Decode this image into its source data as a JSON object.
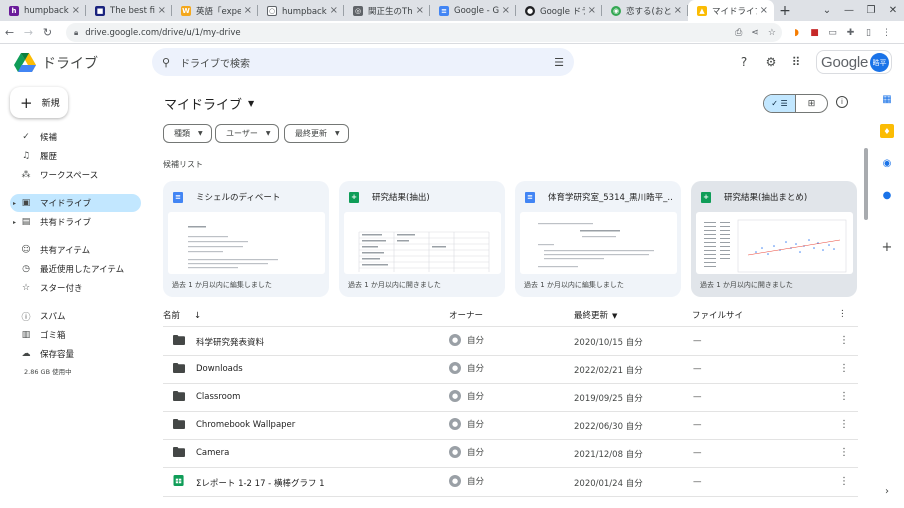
{
  "browser": {
    "tabs": [
      {
        "title": "humpback w",
        "fav_color": "#6a1b9a",
        "fav_glyph": "h"
      },
      {
        "title": "The best fits",
        "fav_color": "#1a237e",
        "fav_glyph": "■"
      },
      {
        "title": "英語「expen",
        "fav_color": "#f4a81d",
        "fav_glyph": "W"
      },
      {
        "title": "humpbackの",
        "fav_color": "#ffffff",
        "fav_glyph": "○"
      },
      {
        "title": "関正生のThe",
        "fav_color": "#5f6368",
        "fav_glyph": "◎"
      },
      {
        "title": "Google - Goo",
        "fav_color": "#4285f4",
        "fav_glyph": "≡"
      },
      {
        "title": "Google ドラ",
        "fav_color": "#202124",
        "fav_glyph": "●"
      },
      {
        "title": "恋する(おと",
        "fav_color": "#34a853",
        "fav_glyph": "◉"
      },
      {
        "title": "マイドライブ -",
        "fav_color": "#fbbc04",
        "fav_glyph": "▲"
      }
    ],
    "url": "drive.google.com/drive/u/1/my-drive"
  },
  "header": {
    "app_name": "ドライブ",
    "search_placeholder": "ドライブで検索",
    "google_word": "Google",
    "avatar_text": "晧平"
  },
  "sidebar": {
    "new_label": "新規",
    "items": [
      {
        "label": "候補",
        "icon": "check-circle-icon",
        "glyph": "✓"
      },
      {
        "label": "履歴",
        "icon": "bell-icon",
        "glyph": "♫"
      },
      {
        "label": "ワークスペース",
        "icon": "workspace-icon",
        "glyph": "⁂"
      },
      {
        "label": "マイドライブ",
        "icon": "my-drive-icon",
        "glyph": "▣"
      },
      {
        "label": "共有ドライブ",
        "icon": "shared-drive-icon",
        "glyph": "▤"
      },
      {
        "label": "共有アイテム",
        "icon": "people-icon",
        "glyph": "☺"
      },
      {
        "label": "最近使用したアイテム",
        "icon": "clock-icon",
        "glyph": "◷"
      },
      {
        "label": "スター付き",
        "icon": "star-icon",
        "glyph": "☆"
      },
      {
        "label": "スパム",
        "icon": "spam-icon",
        "glyph": "ⓘ"
      },
      {
        "label": "ゴミ箱",
        "icon": "trash-icon",
        "glyph": "🗑"
      },
      {
        "label": "保存容量",
        "icon": "cloud-icon",
        "glyph": "☁"
      }
    ],
    "storage_text": "2.86 GB 使用中"
  },
  "main": {
    "title": "マイドライブ",
    "filters": [
      "種類",
      "ユーザー",
      "最終更新"
    ],
    "suggested_label": "候補リスト",
    "cards": [
      {
        "title": "ミシェルのディベート",
        "type": "doc",
        "footer": "過去 1 か月以内に編集しました"
      },
      {
        "title": "研究結果(抽出)",
        "type": "sheet",
        "footer": "過去 1 か月以内に開きました"
      },
      {
        "title": "体育学研究室_5314_黒川晧平_...",
        "type": "doc",
        "footer": "過去 1 か月以内に編集しました"
      },
      {
        "title": "研究結果(抽出まとめ)",
        "type": "sheet",
        "footer": "過去 1 か月以内に開きました"
      }
    ],
    "columns": {
      "name": "名前",
      "owner": "オーナー",
      "modified": "最終更新",
      "size": "ファイルサイ"
    },
    "rows": [
      {
        "name": "科学研究発表資料",
        "type": "folder",
        "owner": "自分",
        "modified": "2020/10/15 自分",
        "size": "—"
      },
      {
        "name": "Downloads",
        "type": "folder",
        "owner": "自分",
        "modified": "2022/02/21 自分",
        "size": "—"
      },
      {
        "name": "Classroom",
        "type": "folder",
        "owner": "自分",
        "modified": "2019/09/25 自分",
        "size": "—"
      },
      {
        "name": "Chromebook Wallpaper",
        "type": "folder",
        "owner": "自分",
        "modified": "2022/06/30 自分",
        "size": "—"
      },
      {
        "name": "Camera",
        "type": "folder",
        "owner": "自分",
        "modified": "2021/12/08 自分",
        "size": "—"
      },
      {
        "name": "Σレポート 1-2 17 - 横棒グラフ 1",
        "type": "sheet",
        "owner": "自分",
        "modified": "2020/01/24 自分",
        "size": "—"
      }
    ]
  },
  "colors": {
    "accent": "#c2e7ff",
    "doc": "#4285f4",
    "sheet": "#0f9d58",
    "folder": "#444746"
  }
}
